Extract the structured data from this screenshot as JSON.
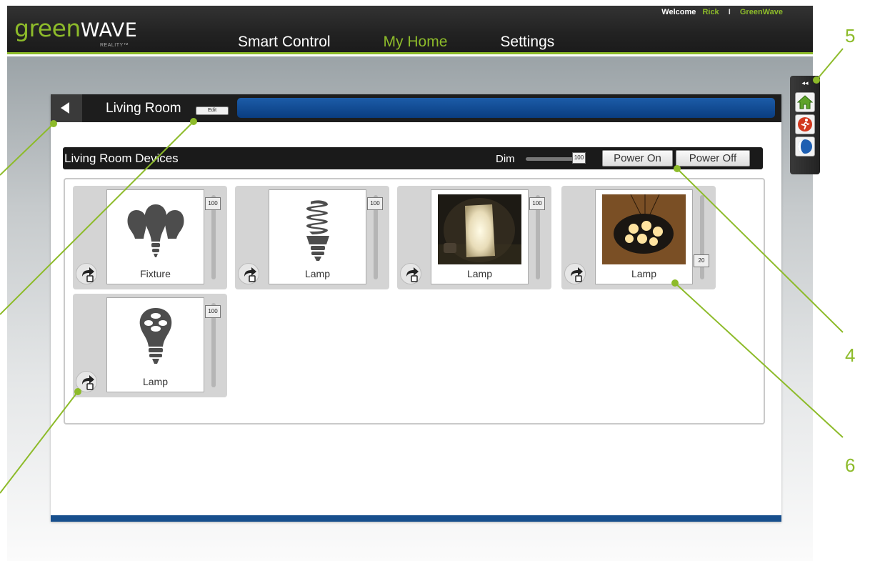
{
  "header": {
    "logo_green": "green",
    "logo_wave": "WAVE",
    "logo_sub": "REALITY™",
    "welcome_label": "Welcome",
    "user_name": "Rick",
    "separator": "I",
    "account_name": "GreenWave",
    "nav": [
      {
        "label": "Smart Control",
        "active": false
      },
      {
        "label": "My Home",
        "active": true
      },
      {
        "label": "Settings",
        "active": false
      }
    ]
  },
  "side_widget": {
    "collapse_label": "◂◂",
    "icons": [
      "home-icon",
      "running-person-icon",
      "moon-icon"
    ]
  },
  "room": {
    "back_icon": "back-arrow-icon",
    "title": "Living Room",
    "edit_label": "Edit",
    "progress_fraction": 1.0
  },
  "devices_bar": {
    "title": "Living Room Devices",
    "dim_label": "Dim",
    "dim_value": "100",
    "power_on_label": "Power On",
    "power_off_label": "Power Off"
  },
  "devices": [
    {
      "label": "Fixture",
      "value": "100",
      "image": "bulb-cluster-icon"
    },
    {
      "label": "Lamp",
      "value": "100",
      "image": "cfl-bulb-icon"
    },
    {
      "label": "Lamp",
      "value": "100",
      "image": "table-lamp-photo"
    },
    {
      "label": "Lamp",
      "value": "20",
      "image": "pendant-lamp-photo"
    },
    {
      "label": "Lamp",
      "value": "100",
      "image": "led-bulb-icon"
    }
  ],
  "callouts": [
    "5",
    "4",
    "6"
  ],
  "colors": {
    "accent_green": "#8dbb2a",
    "header_dark": "#222222",
    "progress_blue": "#0f4a91"
  }
}
